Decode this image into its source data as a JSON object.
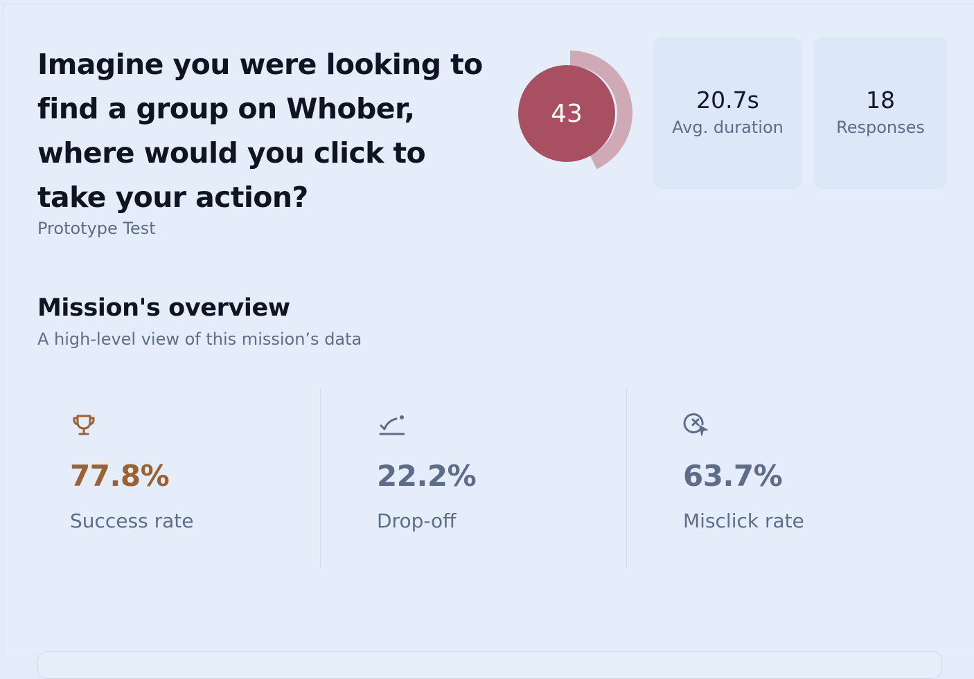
{
  "mission": {
    "question": "Imagine you were looking to find a group on Whober, where would you click to take your action?",
    "type": "Prototype Test",
    "score": "43",
    "score_fraction": 0.43,
    "score_color": "#a84f62",
    "score_ring_color": "#cfa9b6"
  },
  "stats": {
    "duration": {
      "value": "20.7s",
      "label": "Avg. duration"
    },
    "responses": {
      "value": "18",
      "label": "Responses"
    }
  },
  "overview": {
    "title": "Mission's overview",
    "subtitle": "A high-level view of this mission’s data",
    "metrics": [
      {
        "icon": "trophy-icon",
        "value": "77.8%",
        "label": "Success rate",
        "color": "#9a6234"
      },
      {
        "icon": "drop-off-icon",
        "value": "22.2%",
        "label": "Drop-off",
        "color": "#5f6c89"
      },
      {
        "icon": "misclick-icon",
        "value": "63.7%",
        "label": "Misclick rate",
        "color": "#5f6c89"
      }
    ]
  }
}
